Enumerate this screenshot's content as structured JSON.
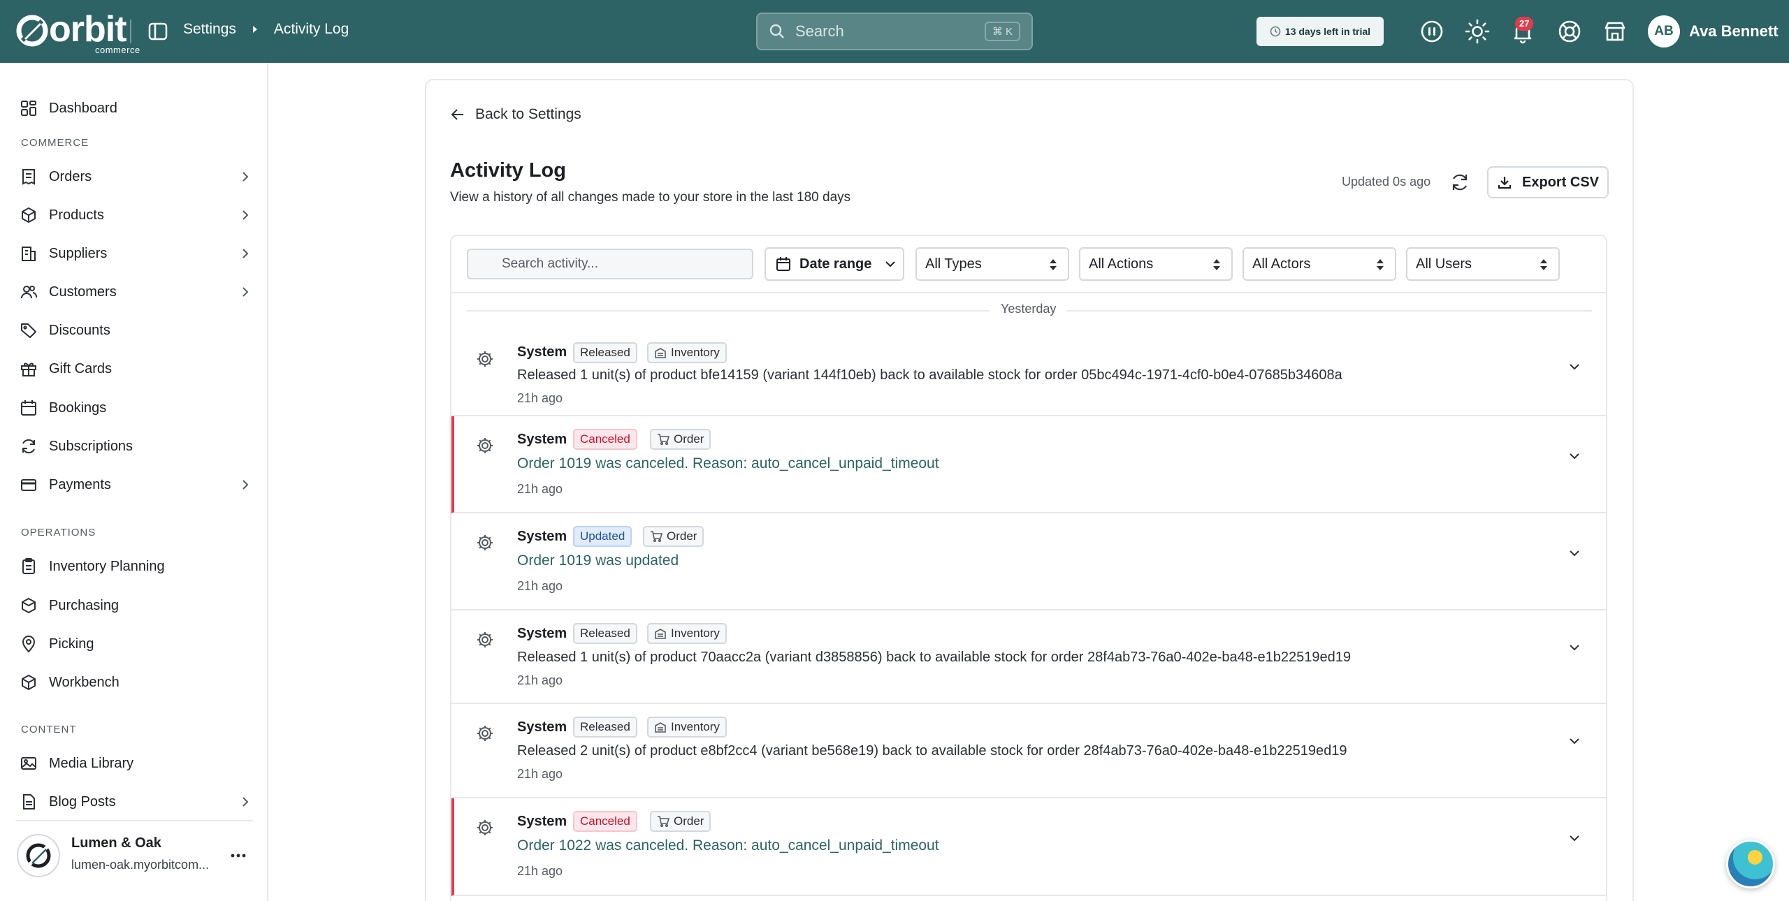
{
  "topbar": {
    "logo": "orbit",
    "logo_sub": "commerce",
    "breadcrumb": [
      "Settings",
      "Activity Log"
    ],
    "search_placeholder": "Search",
    "search_shortcut": "⌘ K",
    "trial": "13 days left in trial",
    "notification_count": "27",
    "user_initials": "AB",
    "user_name": "Ava Bennett"
  },
  "sidebar": {
    "items": [
      {
        "label": "Dashboard"
      },
      {
        "section": "COMMERCE"
      },
      {
        "label": "Orders"
      },
      {
        "label": "Products"
      },
      {
        "label": "Suppliers"
      },
      {
        "label": "Customers"
      },
      {
        "label": "Discounts"
      },
      {
        "label": "Gift Cards"
      },
      {
        "label": "Bookings"
      },
      {
        "label": "Subscriptions"
      },
      {
        "label": "Payments"
      },
      {
        "section": "OPERATIONS"
      },
      {
        "label": "Inventory Planning"
      },
      {
        "label": "Purchasing"
      },
      {
        "label": "Picking"
      },
      {
        "label": "Workbench"
      },
      {
        "section": "CONTENT"
      },
      {
        "label": "Media Library"
      },
      {
        "label": "Blog Posts"
      }
    ],
    "store": {
      "name": "Lumen & Oak",
      "url": "lumen-oak.myorbitcom..."
    }
  },
  "page": {
    "back": "Back to Settings",
    "title": "Activity Log",
    "subtitle": "View a history of all changes made to your store in the last 180 days",
    "updated": "Updated 0s ago",
    "export": "Export CSV"
  },
  "filters": {
    "search_placeholder": "Search activity...",
    "date_range": "Date range",
    "types": "All Types",
    "actions": "All Actions",
    "actors": "All Actors",
    "users": "All Users"
  },
  "day_label": "Yesterday",
  "entries": [
    {
      "actor": "System",
      "action": "Released",
      "type": "Inventory",
      "message": "Released 1 unit(s) of product bfe14159 (variant 144f10eb) back to available stock for order 05bc494c-1971-4cf0-b0e4-07685b34608a",
      "time": "21h ago"
    },
    {
      "actor": "System",
      "action": "Canceled",
      "type": "Order",
      "message": "Order 1019 was canceled. Reason: auto_cancel_unpaid_timeout",
      "time": "21h ago"
    },
    {
      "actor": "System",
      "action": "Updated",
      "type": "Order",
      "message": "Order 1019 was updated",
      "time": "21h ago"
    },
    {
      "actor": "System",
      "action": "Released",
      "type": "Inventory",
      "message": "Released 1 unit(s) of product 70aacc2a (variant d3858856) back to available stock for order 28f4ab73-76a0-402e-ba48-e1b22519ed19",
      "time": "21h ago"
    },
    {
      "actor": "System",
      "action": "Released",
      "type": "Inventory",
      "message": "Released 2 unit(s) of product e8bf2cc4 (variant be568e19) back to available stock for order 28f4ab73-76a0-402e-ba48-e1b22519ed19",
      "time": "21h ago"
    },
    {
      "actor": "System",
      "action": "Canceled",
      "type": "Order",
      "message": "Order 1022 was canceled. Reason: auto_cancel_unpaid_timeout",
      "time": "21h ago"
    }
  ],
  "colors": {
    "brand": "#2d6364",
    "canceled": "#e23b4b",
    "updated": "#1f4f9e"
  }
}
